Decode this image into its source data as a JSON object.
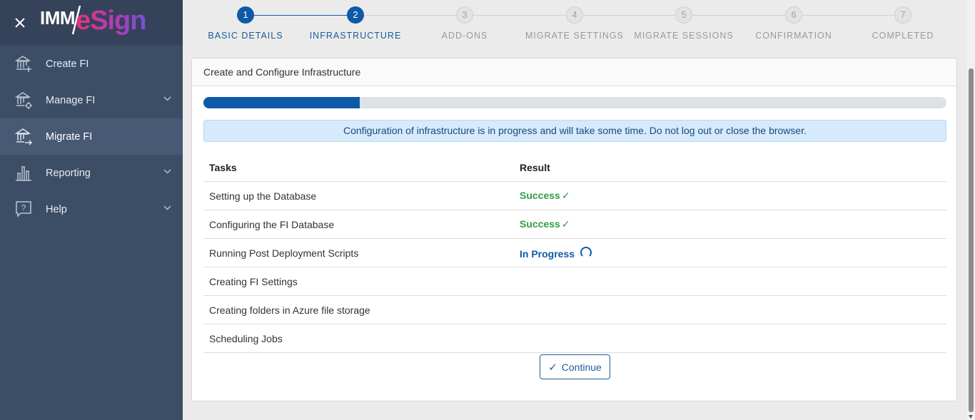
{
  "brand": {
    "logo_imm": "IMM",
    "logo_esign": "eSign"
  },
  "sidebar": {
    "items": [
      {
        "label": "Create FI",
        "icon": "bank-plus-icon",
        "has_chevron": false
      },
      {
        "label": "Manage FI",
        "icon": "bank-gear-icon",
        "has_chevron": true
      },
      {
        "label": "Migrate FI",
        "icon": "bank-arrow-icon",
        "has_chevron": false,
        "active": true
      },
      {
        "label": "Reporting",
        "icon": "bar-chart-icon",
        "has_chevron": true
      },
      {
        "label": "Help",
        "icon": "help-icon",
        "has_chevron": true
      }
    ]
  },
  "stepper": {
    "steps": [
      {
        "number": "1",
        "label": "BASIC DETAILS",
        "state": "done"
      },
      {
        "number": "2",
        "label": "INFRASTRUCTURE",
        "state": "current"
      },
      {
        "number": "3",
        "label": "ADD-ONS",
        "state": "todo"
      },
      {
        "number": "4",
        "label": "MIGRATE SETTINGS",
        "state": "todo"
      },
      {
        "number": "5",
        "label": "MIGRATE SESSIONS",
        "state": "todo"
      },
      {
        "number": "6",
        "label": "CONFIRMATION",
        "state": "todo"
      },
      {
        "number": "7",
        "label": "COMPLETED",
        "state": "todo"
      }
    ]
  },
  "panel": {
    "title": "Create and Configure Infrastructure",
    "progress_fraction": 0.21,
    "alert": "Configuration of infrastructure is in progress and will take some time. Do not log out or close the browser.",
    "table": {
      "headers": {
        "task": "Tasks",
        "result": "Result"
      },
      "rows": [
        {
          "task": "Setting up the Database",
          "result": "Success",
          "status": "success"
        },
        {
          "task": "Configuring the FI Database",
          "result": "Success",
          "status": "success"
        },
        {
          "task": "Running Post Deployment Scripts",
          "result": "In Progress",
          "status": "in-progress"
        },
        {
          "task": "Creating FI Settings",
          "result": "",
          "status": "pending"
        },
        {
          "task": "Creating folders in Azure file storage",
          "result": "",
          "status": "pending"
        },
        {
          "task": "Scheduling Jobs",
          "result": "",
          "status": "pending"
        }
      ]
    },
    "continue_label": "Continue"
  },
  "colors": {
    "sidebar_bg": "#3c4e66",
    "brand_bg": "#34435a",
    "accent": "#0e5aa7",
    "success": "#2e9d45",
    "alert_bg": "#d6eafc"
  }
}
